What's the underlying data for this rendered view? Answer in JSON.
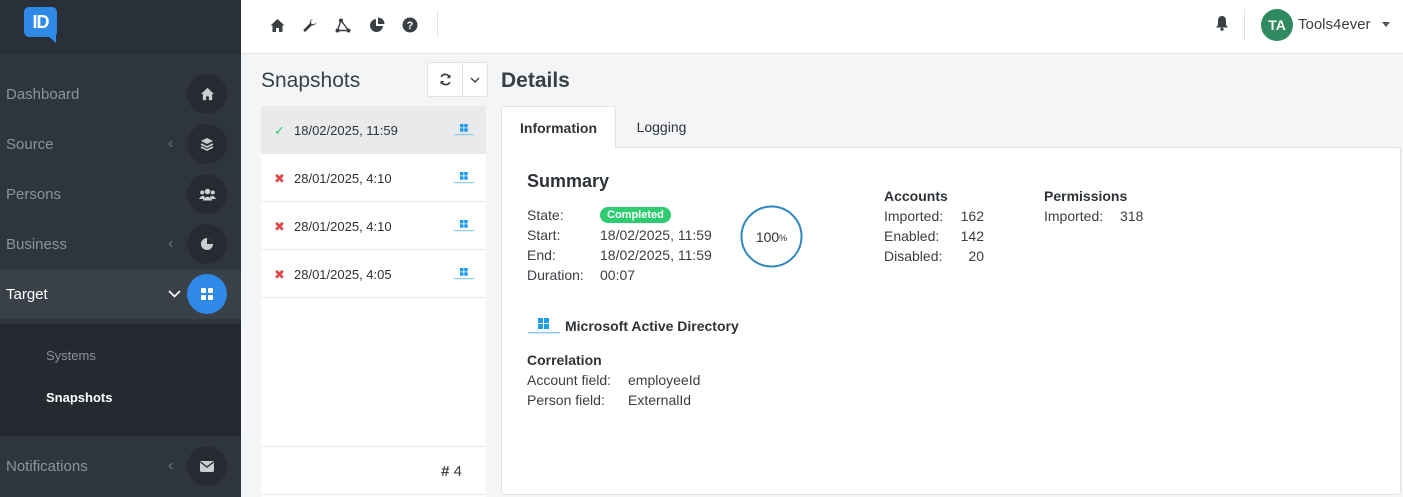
{
  "app": {
    "logo_text": "ID"
  },
  "sidebar": {
    "items": [
      {
        "label": "Dashboard",
        "icon": "home-icon"
      },
      {
        "label": "Source",
        "icon": "layers-icon"
      },
      {
        "label": "Persons",
        "icon": "users-icon"
      },
      {
        "label": "Business",
        "icon": "pie-icon"
      },
      {
        "label": "Target",
        "icon": "grid-icon"
      },
      {
        "label": "Notifications",
        "icon": "envelope-icon"
      }
    ],
    "sub_items": [
      {
        "label": "Systems"
      },
      {
        "label": "Snapshots"
      }
    ]
  },
  "topbar": {
    "icons": [
      "home-icon",
      "wrench-icon",
      "network-icon",
      "chart-pie-icon",
      "help-icon"
    ],
    "user": {
      "initials": "TA",
      "name": "Tools4ever"
    }
  },
  "snapshots": {
    "title": "Snapshots",
    "rows": [
      {
        "status": "success",
        "status_glyph": "✓",
        "date": "18/02/2025, 11:59"
      },
      {
        "status": "error",
        "status_glyph": "✖",
        "date": "28/01/2025, 4:10"
      },
      {
        "status": "error",
        "status_glyph": "✖",
        "date": "28/01/2025, 4:10"
      },
      {
        "status": "error",
        "status_glyph": "✖",
        "date": "28/01/2025, 4:05"
      }
    ],
    "count_prefix": "#",
    "count": "4"
  },
  "details": {
    "title": "Details",
    "tabs": [
      {
        "label": "Information"
      },
      {
        "label": "Logging"
      }
    ],
    "summary": {
      "title": "Summary",
      "state_label": "State:",
      "state_value": "Completed",
      "start_label": "Start:",
      "start_value": "18/02/2025, 11:59",
      "end_label": "End:",
      "end_value": "18/02/2025, 11:59",
      "duration_label": "Duration:",
      "duration_value": "00:07",
      "progress_value": "100",
      "progress_unit": "%"
    },
    "accounts": {
      "title": "Accounts",
      "imported_label": "Imported:",
      "imported_value": "162",
      "enabled_label": "Enabled:",
      "enabled_value": "142",
      "disabled_label": "Disabled:",
      "disabled_value": "20"
    },
    "permissions": {
      "title": "Permissions",
      "imported_label": "Imported:",
      "imported_value": "318"
    },
    "system": {
      "name": "Microsoft Active Directory"
    },
    "correlation": {
      "title": "Correlation",
      "account_field_label": "Account field:",
      "account_field_value": "employeeId",
      "person_field_label": "Person field:",
      "person_field_value": "ExternalId"
    }
  },
  "colors": {
    "accent": "#2e8ae6",
    "success": "#2ecc71",
    "error": "#e04848",
    "sidebar_bg": "#2f353d",
    "avatar": "#2f8a5f"
  }
}
